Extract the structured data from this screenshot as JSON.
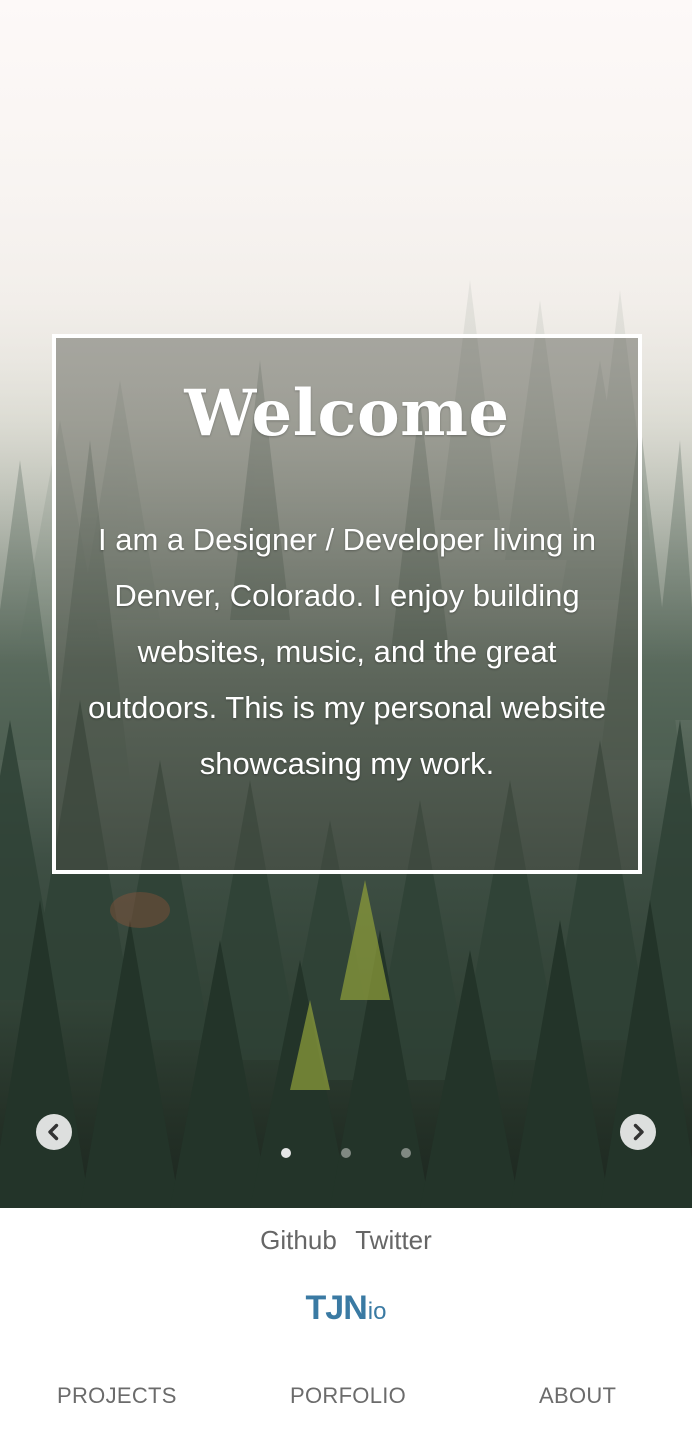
{
  "welcome": {
    "title": "Welcome",
    "text": "I am a Designer / Developer living in Denver, Colorado. I enjoy building websites, music, and the great outdoors. This is my personal website showcasing my work."
  },
  "carousel": {
    "prev_icon": "chevron-left-icon",
    "next_icon": "chevron-right-icon",
    "slide_count": 3,
    "active_slide": 1
  },
  "social": {
    "github": "Github",
    "twitter": "Twitter"
  },
  "logo": {
    "main": "TJN",
    "suffix": "io",
    "color": "#3a7aa3"
  },
  "nav": {
    "projects": "PROJECTS",
    "portfolio": "PORFOLIO",
    "about": "ABOUT"
  }
}
